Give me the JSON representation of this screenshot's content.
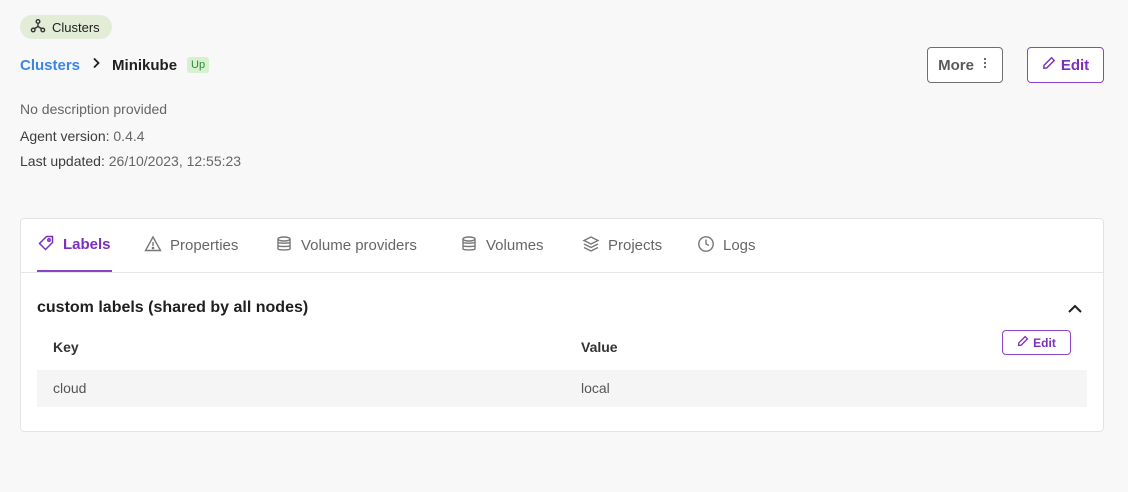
{
  "chip": {
    "label": "Clusters",
    "icon": "cluster-icon"
  },
  "breadcrumb": {
    "parent": "Clusters",
    "current": "Minikube",
    "status": "Up"
  },
  "actions": {
    "more_label": "More",
    "edit_label": "Edit"
  },
  "meta": {
    "description": "No description provided",
    "agent_version_label": "Agent version:",
    "agent_version": "0.4.4",
    "last_updated_label": "Last updated:",
    "last_updated": "26/10/2023, 12:55:23"
  },
  "tabs": [
    {
      "label": "Labels",
      "icon": "tag-icon",
      "active": true
    },
    {
      "label": "Properties",
      "icon": "warning-icon",
      "active": false
    },
    {
      "label": "Volume providers",
      "icon": "database-icon",
      "active": false
    },
    {
      "label": "Volumes",
      "icon": "database-icon",
      "active": false
    },
    {
      "label": "Projects",
      "icon": "layers-icon",
      "active": false
    },
    {
      "label": "Logs",
      "icon": "clock-icon",
      "active": false
    }
  ],
  "labels_section": {
    "title": "custom labels (shared by all nodes)",
    "edit_label": "Edit",
    "columns": [
      "Key",
      "Value"
    ],
    "rows": [
      {
        "key": "cloud",
        "value": "local"
      }
    ]
  },
  "colors": {
    "accent": "#7b2fbf",
    "link": "#3a86e6",
    "status_up_bg": "#d6f0d2",
    "chip_bg": "#e3ecd6"
  }
}
